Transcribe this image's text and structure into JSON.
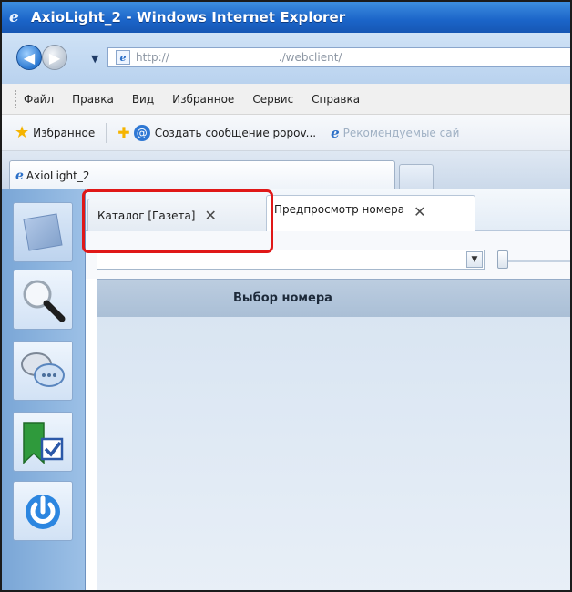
{
  "window": {
    "title": "AxioLight_2 - Windows Internet Explorer"
  },
  "address": {
    "protocol": "http://",
    "path": "./webclient/"
  },
  "menu": {
    "items": [
      "Файл",
      "Правка",
      "Вид",
      "Избранное",
      "Сервис",
      "Справка"
    ]
  },
  "favorites": {
    "label": "Избранное",
    "link1": "Создать сообщение popov...",
    "link2": "Рекомендуемые сай"
  },
  "browser_tab": {
    "title": "AxioLight_2"
  },
  "app_tabs": [
    {
      "label": "Каталог [Газета]",
      "close": "✕"
    },
    {
      "label": "Предпросмотр номера",
      "close": "✕"
    }
  ],
  "grid": {
    "column_header": "Выбор номера"
  },
  "icons": {
    "sidebar": [
      "folder-icon",
      "search-icon",
      "chat-icon",
      "tag-check-icon",
      "power-icon"
    ]
  },
  "colors": {
    "titlebar": "#1b64c8",
    "highlight": "#e01818",
    "sidebar": "#7aa6d6"
  }
}
